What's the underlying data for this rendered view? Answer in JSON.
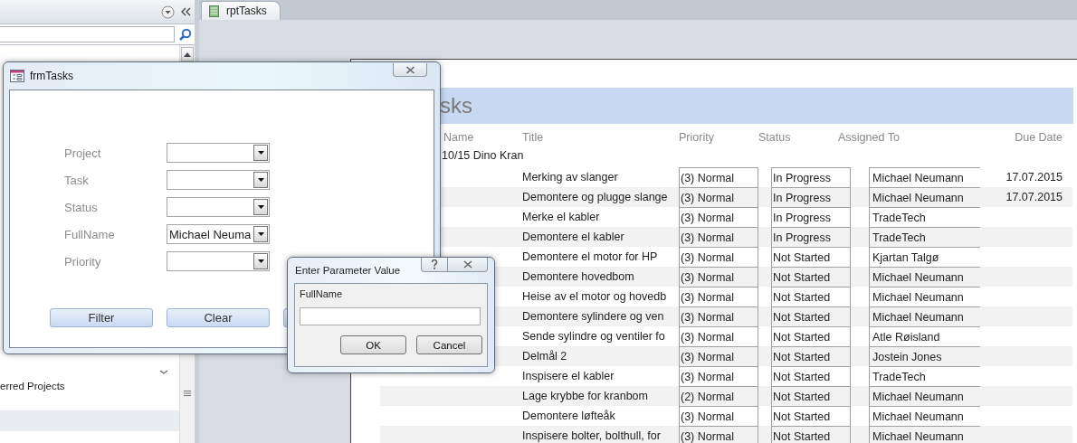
{
  "navigation_pane": {
    "items": [
      {
        "label": "erred Projects",
        "selected": false
      }
    ]
  },
  "tabs": [
    {
      "label": "rptTasks",
      "selected": true
    }
  ],
  "report": {
    "title": "sks",
    "columns": [
      "Name",
      "Title",
      "Priority",
      "Status",
      "Assigned To",
      "Due Date"
    ],
    "group": "10/15 Dino Kran",
    "rows": [
      {
        "title": "Merking av slanger",
        "priority": "(3) Normal",
        "status": "In Progress",
        "assigned_to": "Michael Neumann",
        "due_date": "17.07.2015"
      },
      {
        "title": "Demontere og plugge slange",
        "priority": "(3) Normal",
        "status": "In Progress",
        "assigned_to": "Michael Neumann",
        "due_date": "17.07.2015"
      },
      {
        "title": "Merke el kabler",
        "priority": "(3) Normal",
        "status": "In Progress",
        "assigned_to": "TradeTech"
      },
      {
        "title": "Demontere el kabler",
        "priority": "(3) Normal",
        "status": "In Progress",
        "assigned_to": "TradeTech"
      },
      {
        "title": "Demontere el motor for HP",
        "priority": "(3) Normal",
        "status": "Not Started",
        "assigned_to": "Kjartan Talgø"
      },
      {
        "title": "Demontere hovedbom",
        "priority": "(3) Normal",
        "status": "Not Started",
        "assigned_to": "Michael Neumann"
      },
      {
        "title": "Heise av el motor og hovedb",
        "priority": "(3) Normal",
        "status": "Not Started",
        "assigned_to": "Michael Neumann"
      },
      {
        "title": "Demontere sylindere og ven",
        "priority": "(3) Normal",
        "status": "Not Started",
        "assigned_to": "Michael Neumann"
      },
      {
        "title": "Sende sylindre og ventiler fo",
        "priority": "(3) Normal",
        "status": "Not Started",
        "assigned_to": "Atle Røisland"
      },
      {
        "title": "Delmål 2",
        "priority": "(3) Normal",
        "status": "Not Started",
        "assigned_to": "Jostein Jones"
      },
      {
        "title": "Inspisere el kabler",
        "priority": "(3) Normal",
        "status": "Not Started",
        "assigned_to": "TradeTech"
      },
      {
        "title": "Lage krybbe for kranbom",
        "priority": "(2) Normal",
        "status": "Not Started",
        "assigned_to": "Michael Neumann"
      },
      {
        "title": "Demontere løfteåk",
        "priority": "(3) Normal",
        "status": "Not Started",
        "assigned_to": "Michael Neumann"
      },
      {
        "title": "Inspisere bolter, bolthull, for",
        "priority": "(3) Normal",
        "status": "Not Started",
        "assigned_to": "Michael Neumann"
      }
    ]
  },
  "form": {
    "title": "frmTasks",
    "fields": [
      {
        "label": "Project"
      },
      {
        "label": "Task"
      },
      {
        "label": "Status"
      },
      {
        "label": "FullName",
        "value": "Michael Neuma"
      },
      {
        "label": "Priority"
      }
    ],
    "buttons": [
      "Filter",
      "Clear"
    ]
  },
  "dialog": {
    "title": "Enter Parameter Value",
    "prompt": "FullName",
    "buttons": [
      "OK",
      "Cancel"
    ]
  }
}
